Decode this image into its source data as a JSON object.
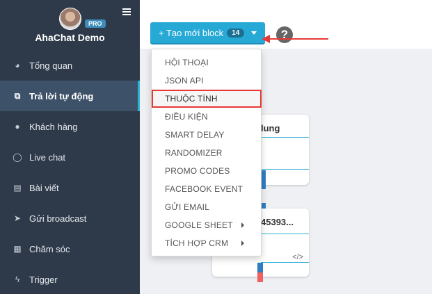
{
  "sidebar": {
    "app_name": "AhaChat Demo",
    "pro_badge": "PRO",
    "items": [
      {
        "label": "Tổng quan",
        "icon": "dashboard-icon",
        "glyph": "◕"
      },
      {
        "label": "Trả lời tự động",
        "icon": "sitemap-icon",
        "glyph": "⧉",
        "active": true
      },
      {
        "label": "Khách hàng",
        "icon": "user-icon",
        "glyph": "●"
      },
      {
        "label": "Live chat",
        "icon": "chat-bubble-icon",
        "glyph": "◯"
      },
      {
        "label": "Bài viết",
        "icon": "book-icon",
        "glyph": "▤"
      },
      {
        "label": "Gửi broadcast",
        "icon": "paper-plane-icon",
        "glyph": "➤"
      },
      {
        "label": "Chăm sóc",
        "icon": "calendar-icon",
        "glyph": "▦"
      },
      {
        "label": "Trigger",
        "icon": "bolt-icon",
        "glyph": "ϟ"
      }
    ]
  },
  "toolbar": {
    "create_label": "+ Tạo mới block",
    "create_count": "14",
    "help_glyph": "?"
  },
  "dropdown": {
    "items": [
      {
        "label": "HỘI THOẠI"
      },
      {
        "label": "JSON API"
      },
      {
        "label": "THUỘC TÍNH",
        "highlighted": true
      },
      {
        "label": "ĐIỀU KIỆN"
      },
      {
        "label": "SMART DELAY"
      },
      {
        "label": "RANDOMIZER"
      },
      {
        "label": "PROMO CODES"
      },
      {
        "label": "FACEBOOK EVENT"
      },
      {
        "label": "GỬI EMAIL"
      },
      {
        "label": "GOOGLE SHEET",
        "submenu": true
      },
      {
        "label": "TÍCH HỢP CRM",
        "submenu": true
      }
    ]
  },
  "canvas": {
    "node1_title": "lung",
    "node2_title": "45393...",
    "code_glyph": "</>"
  },
  "colors": {
    "sidebar": "#2e3a4a",
    "accent": "#27a9d6",
    "highlight": "#e53935"
  }
}
